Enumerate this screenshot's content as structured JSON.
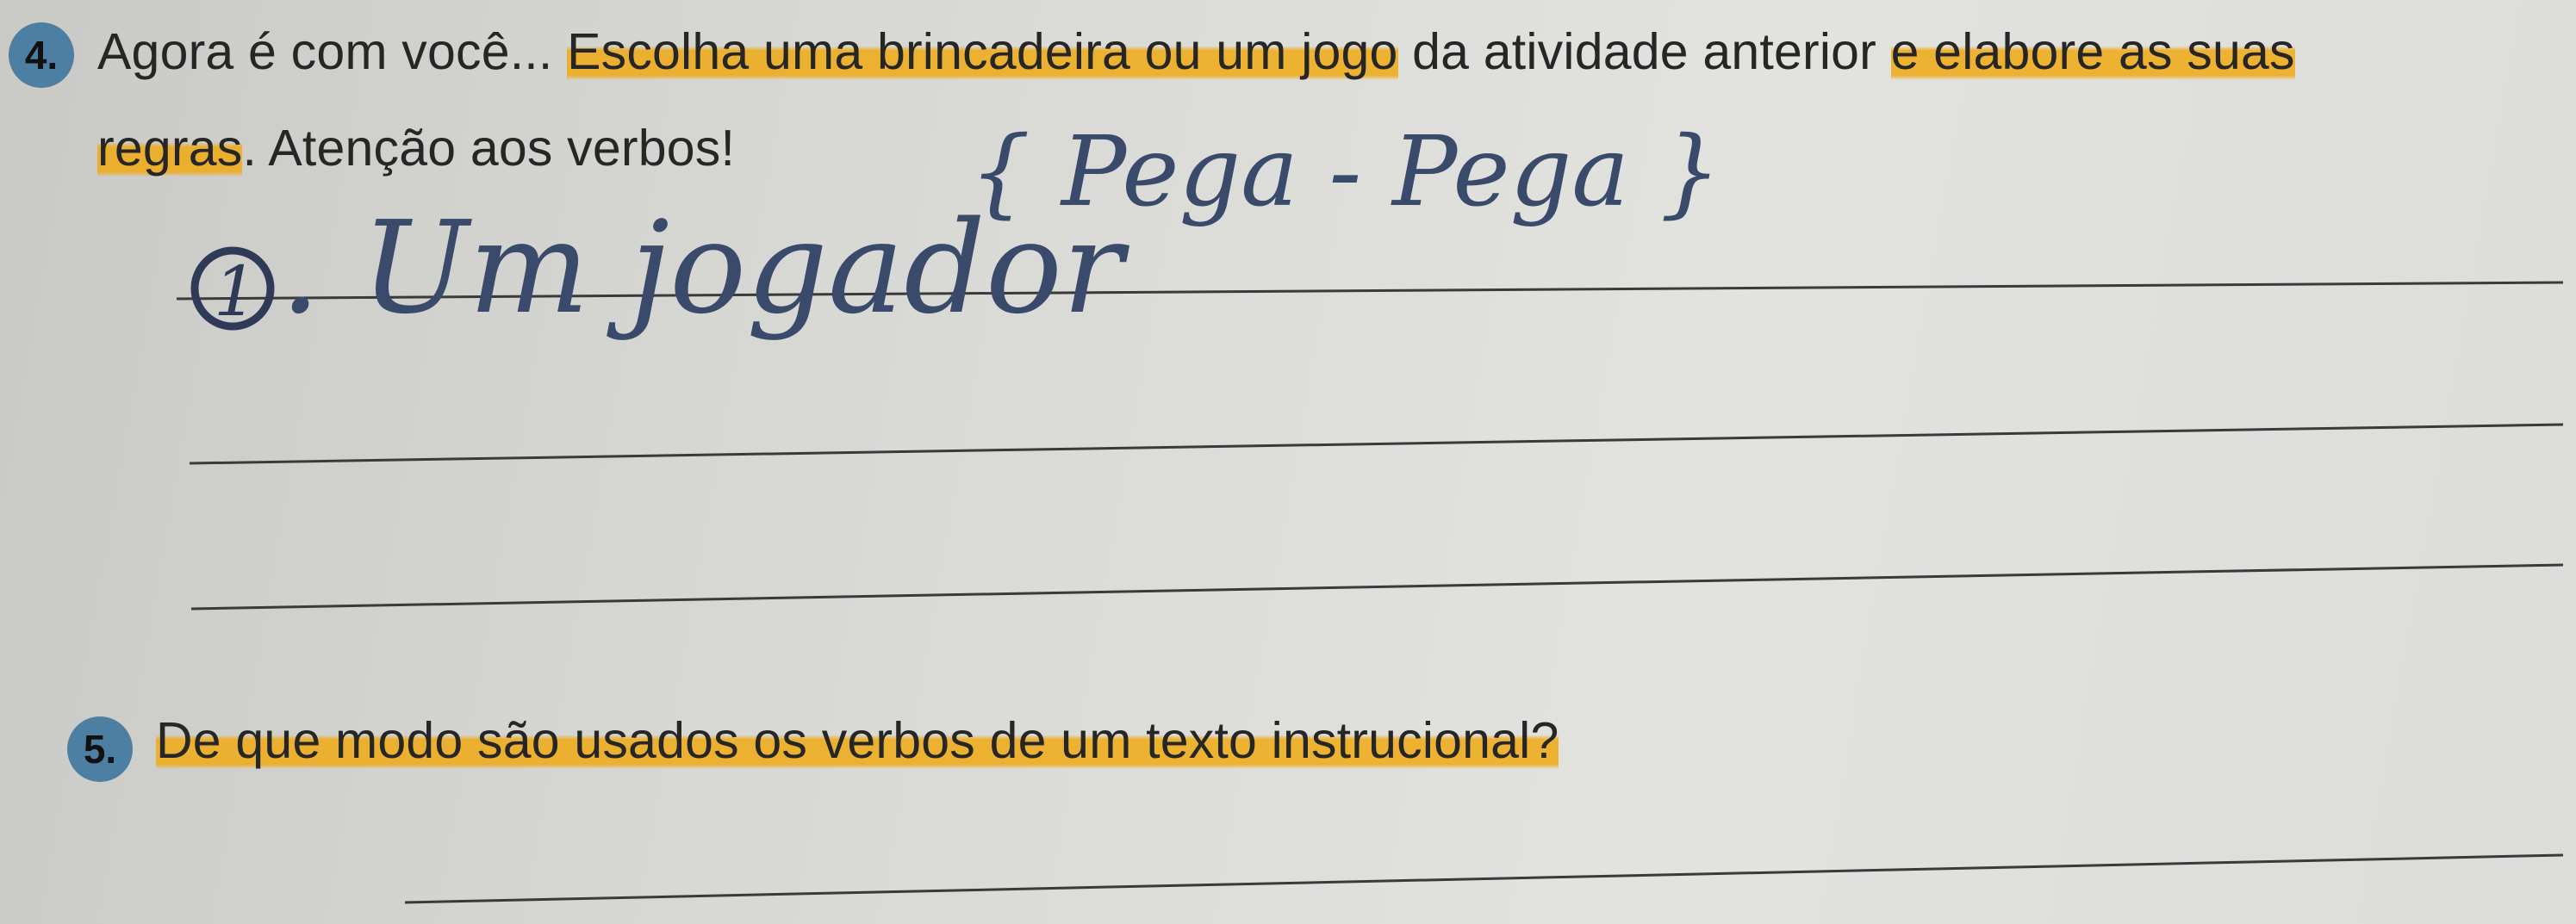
{
  "question4": {
    "number": "4.",
    "line1_plain": "Agora é com você... ",
    "line1_hl": "Escolha uma brincadeira ou um jogo",
    "line1_mid": " da atividade anterior ",
    "line1_hl2": "e elabore as suas",
    "line2_hl": "regras",
    "line2_plain": ". Atenção aos verbos!"
  },
  "handwriting": {
    "title": "{ Pega - Pega }",
    "answer_number": "1",
    "answer_text": ". Um jogador"
  },
  "question5": {
    "number": "5.",
    "text": "De que modo são usados os verbos de um texto instrucional?"
  },
  "colors": {
    "highlight": "#f0aa14",
    "badge": "#4d7fa3",
    "ink": "#3a4a6a",
    "paper": "#dcdcd9"
  }
}
